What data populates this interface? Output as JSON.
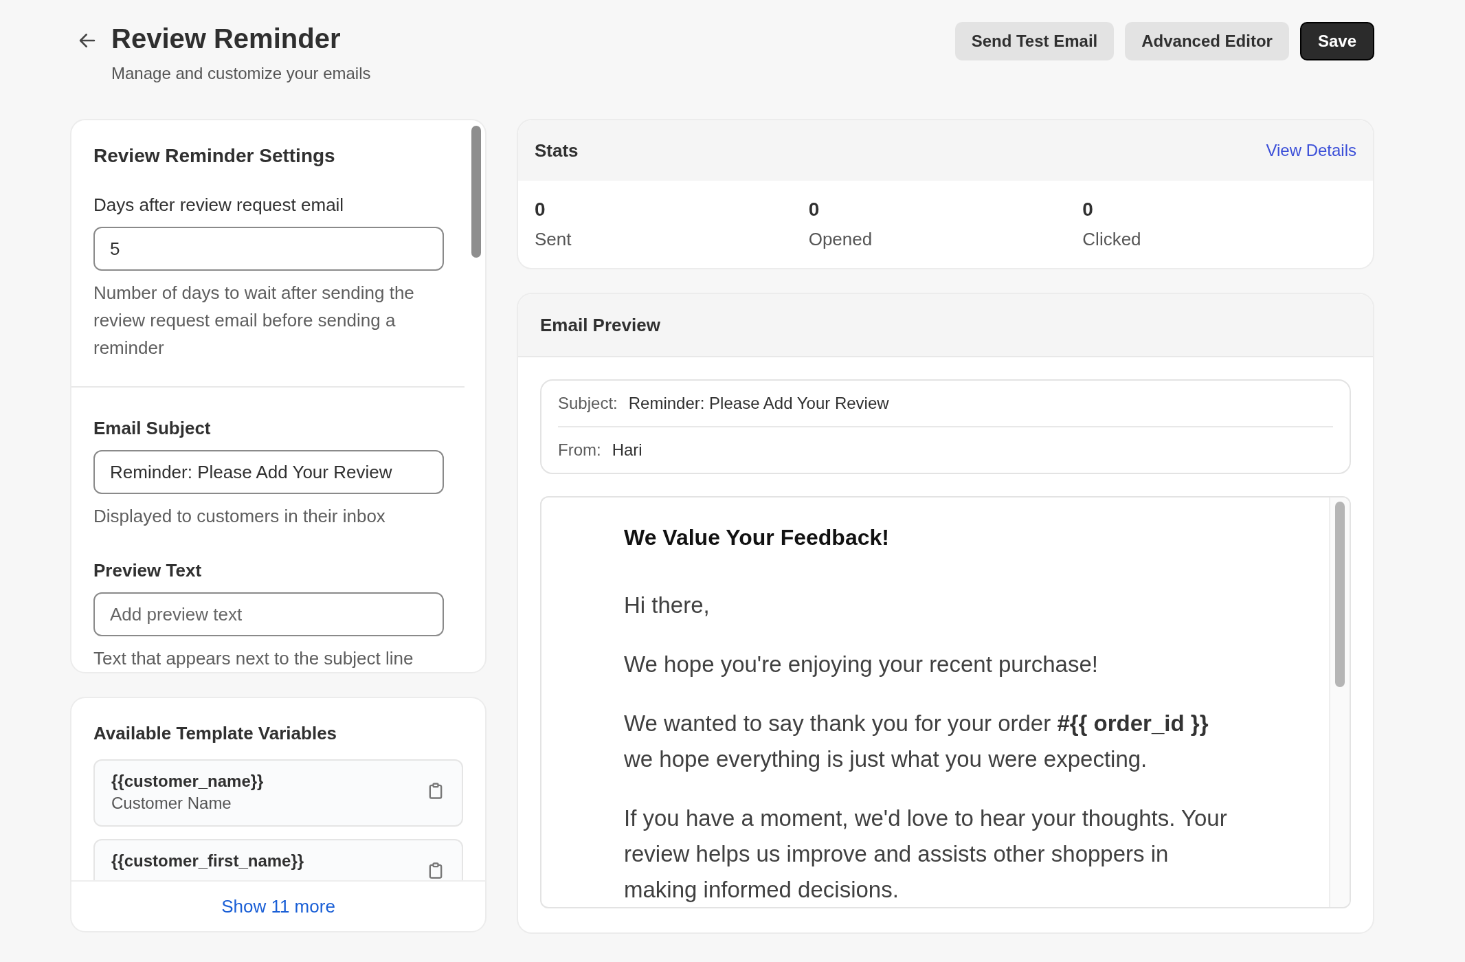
{
  "header": {
    "title": "Review Reminder",
    "subtitle": "Manage and customize your emails"
  },
  "actions": [
    {
      "label": "Send Test Email",
      "kind": "secondary"
    },
    {
      "label": "Advanced Editor",
      "kind": "secondary"
    },
    {
      "label": "Save",
      "kind": "primary"
    }
  ],
  "settings": {
    "title": "Review Reminder Settings",
    "sections": [
      {
        "fields": [
          {
            "kind": "plain",
            "label": "Days after review request email",
            "value": "5",
            "help": "Number of days to wait after sending the review request email before sending a reminder"
          }
        ]
      },
      {
        "fields": [
          {
            "kind": "heading",
            "label": "Email Subject",
            "value": "Reminder: Please Add Your Review",
            "help": "Displayed to customers in their inbox"
          },
          {
            "kind": "heading",
            "label": "Preview Text",
            "placeholder": "Add preview text",
            "help": "Text that appears next to the subject line"
          }
        ]
      }
    ]
  },
  "variables": {
    "title": "Available Template Variables",
    "items": [
      {
        "name": "{{customer_name}}",
        "description": "Customer Name"
      },
      {
        "name": "{{customer_first_name}}"
      }
    ],
    "show_more": "Show 11 more"
  },
  "stats": {
    "title": "Stats",
    "link": "View Details",
    "items": [
      {
        "value": "0",
        "label": "Sent"
      },
      {
        "value": "0",
        "label": "Opened"
      },
      {
        "value": "0",
        "label": "Clicked"
      }
    ]
  },
  "preview": {
    "title": "Email Preview",
    "meta": [
      {
        "label": "Subject:",
        "value": "Reminder: Please Add Your Review"
      },
      {
        "label": "From:",
        "value": "Hari"
      }
    ],
    "email": {
      "heading": "We Value Your Feedback!",
      "paragraphs": [
        "Hi there,",
        "We hope you're enjoying your recent purchase!",
        "We wanted to say thank you for your order **#{{ order_id }}** we hope everything is just what you were expecting.",
        "If you have a moment, we'd love to hear your thoughts. Your review helps us improve and assists other shoppers in making informed decisions."
      ]
    }
  }
}
